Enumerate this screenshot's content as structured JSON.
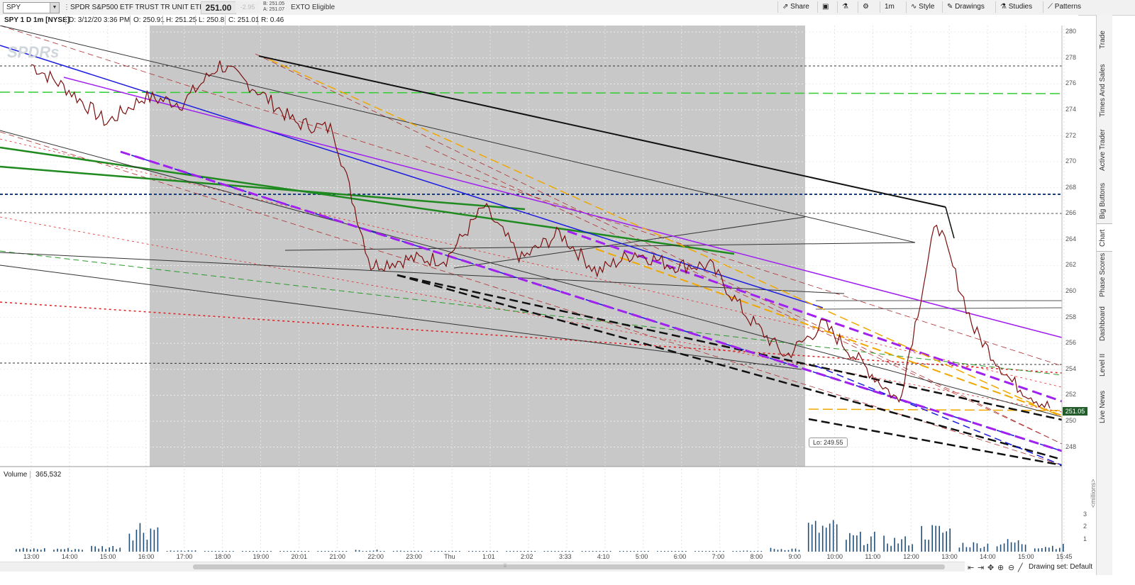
{
  "toolbar": {
    "symbol": "SPY",
    "description": "SPDR S&P500 ETF TRUST TR UNIT ETF",
    "last_price": "251.00",
    "change": "-2.95",
    "bid": "B: 251.05",
    "ask": "A: 251.07",
    "exto": "EXTO Eligible",
    "share": "Share",
    "interval": "1m",
    "style": "Style",
    "drawings": "Drawings",
    "studies": "Studies",
    "patterns": "Patterns"
  },
  "info": {
    "title": "SPY 1 D 1m [NYSE]",
    "date": "D: 3/12/20 3:36 PM",
    "open": "O: 250.91",
    "high": "H: 251.25",
    "low": "L: 250.8",
    "close": "C: 251.01",
    "range": "R: 0.46"
  },
  "watermark": "SPDRs",
  "right_tabs": [
    "Trade",
    "Times And Sales",
    "Active Trader",
    "Big Buttons",
    "Chart",
    "Phase Scores",
    "Dashboard",
    "Level II",
    "Live News"
  ],
  "active_tab": "Chart",
  "price_tag": "251.05",
  "lo_label": "Lo: 249.55",
  "volume": {
    "label": "Volume",
    "value": "365,532",
    "units": "<millions>",
    "ticks": [
      "3",
      "2",
      "1"
    ]
  },
  "time_labels": [
    "13:00",
    "14:00",
    "15:00",
    "16:00",
    "17:00",
    "18:00",
    "19:00",
    "20:01",
    "21:00",
    "22:00",
    "23:00",
    "Thu",
    "1:01",
    "2:02",
    "3:33",
    "4:10",
    "5:00",
    "6:00",
    "7:00",
    "8:00",
    "9:00",
    "10:00",
    "11:00",
    "12:00",
    "13:00",
    "14:00",
    "15:00",
    "15:45"
  ],
  "drawing_set": "Drawing set: Default",
  "colors": {
    "price": "#7a0f0f",
    "volume": "#1f4e79",
    "after_hours_shade": "#c8c8c8",
    "last_price_tag": "#215c2a"
  },
  "chart_data": {
    "type": "line",
    "title": "SPY 1 D 1m [NYSE]",
    "ylim": [
      246.5,
      280.5
    ],
    "y_ticks": [
      280,
      278,
      276,
      274,
      272,
      270,
      268,
      266,
      264,
      262,
      260,
      258,
      256,
      254,
      252,
      250,
      248
    ],
    "x": [
      "13:00",
      "14:00",
      "15:00",
      "16:00",
      "17:00",
      "18:00",
      "19:00",
      "20:01",
      "21:00",
      "22:00",
      "23:00",
      "Thu",
      "1:01",
      "2:02",
      "3:33",
      "4:10",
      "5:00",
      "6:00",
      "7:00",
      "8:00",
      "9:00",
      "10:00",
      "11:00",
      "12:00",
      "13:00",
      "14:00",
      "15:00",
      "15:36"
    ],
    "series": [
      {
        "values": [
          277.5,
          275.5,
          273,
          275,
          274.5,
          277.5,
          275.5,
          273,
          272.5,
          262,
          262.5,
          262.5,
          266.5,
          262.5,
          264.5,
          261.5,
          263,
          262,
          262,
          258,
          255,
          257.5,
          254.5,
          251.5,
          265.5,
          257,
          253,
          251
        ]
      }
    ],
    "volume_millions": [
      0.3,
      0.3,
      0.5,
      2.6,
      0.1,
      0.05,
      0.05,
      0.05,
      0.05,
      0.15,
      0.1,
      0.05,
      0.05,
      0.05,
      0.05,
      0.05,
      0.05,
      0.05,
      0.05,
      0.08,
      0.3,
      2.5,
      1.5,
      1.2,
      2.2,
      0.8,
      1.0,
      0.6
    ]
  }
}
